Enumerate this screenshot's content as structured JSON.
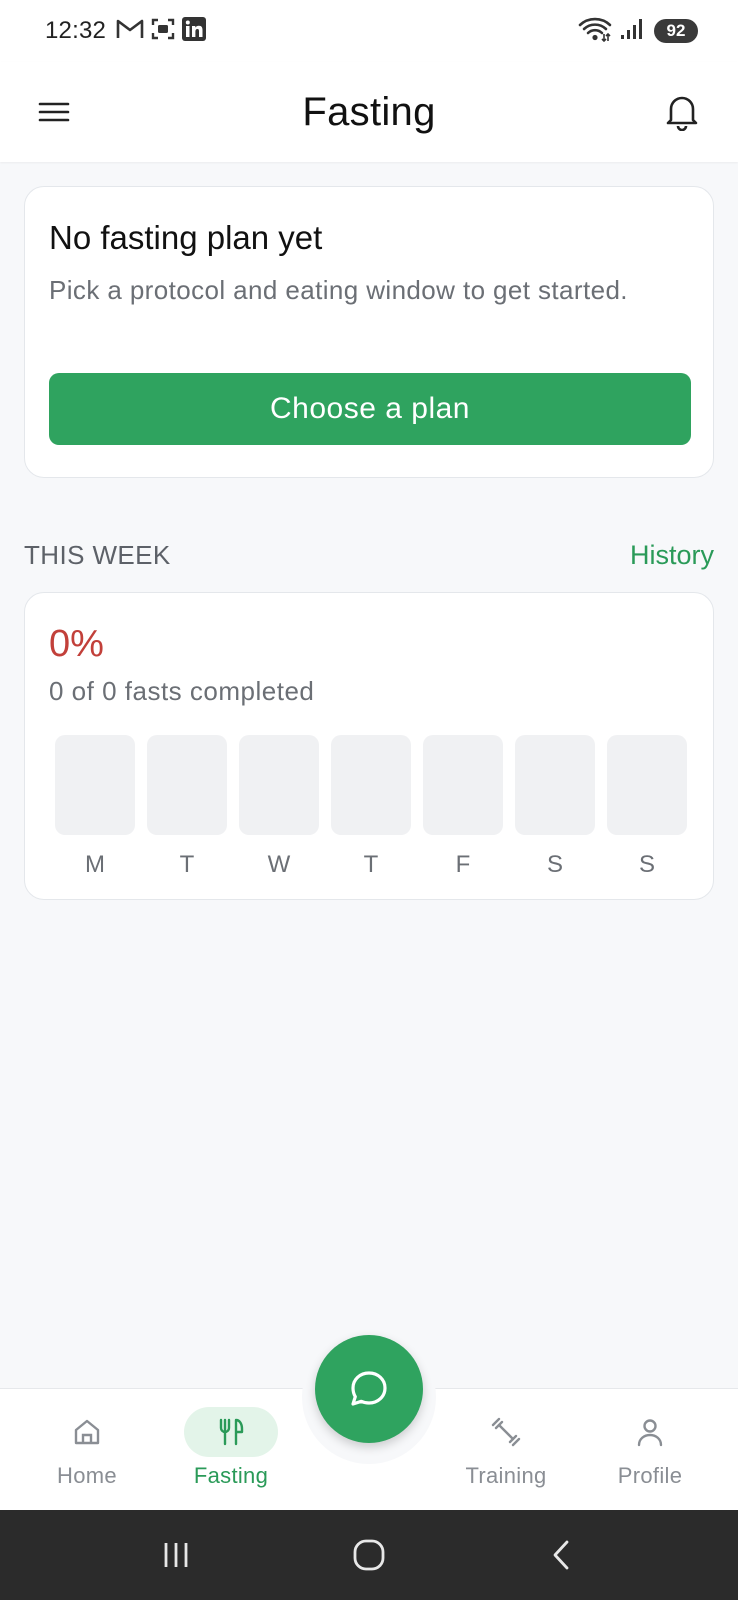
{
  "status_bar": {
    "time": "12:32",
    "battery": "92",
    "icons": [
      "gmail-icon",
      "screenshot-icon",
      "linkedin-icon",
      "wifi-icon",
      "signal-icon"
    ]
  },
  "header": {
    "title": "Fasting"
  },
  "plan_card": {
    "title": "No fasting plan yet",
    "description": "Pick a protocol and eating window to get started.",
    "button_label": "Choose a plan"
  },
  "week_section": {
    "title": "THIS WEEK",
    "history_label": "History",
    "percent": "0%",
    "summary": "0 of 0 fasts completed",
    "days": [
      "M",
      "T",
      "W",
      "T",
      "F",
      "S",
      "S"
    ]
  },
  "bottom_nav": {
    "items": [
      {
        "label": "Home",
        "icon": "home-icon"
      },
      {
        "label": "Fasting",
        "icon": "fork-knife-icon"
      },
      {
        "label": "Training",
        "icon": "dumbbell-icon"
      },
      {
        "label": "Profile",
        "icon": "person-icon"
      }
    ],
    "active": "Fasting"
  },
  "colors": {
    "accent": "#2fa35f",
    "accent_text": "#2a9a58",
    "percent": "#c2403a",
    "background": "#f7f8fa"
  }
}
